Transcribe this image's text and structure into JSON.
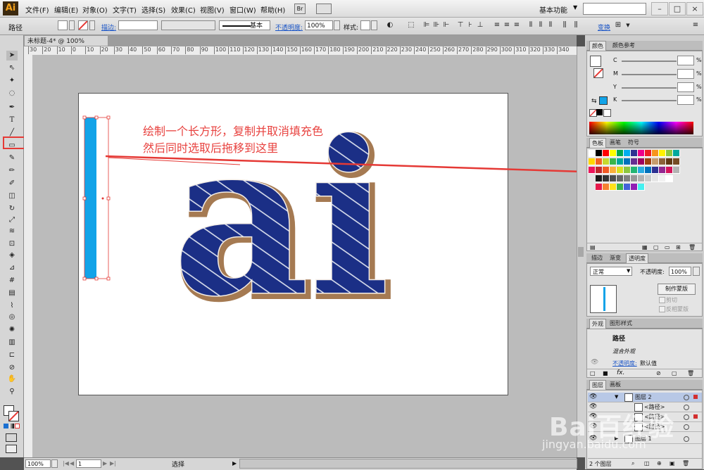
{
  "app": {
    "logo": "Ai",
    "menus": [
      "文件(F)",
      "编辑(E)",
      "对象(O)",
      "文字(T)",
      "选择(S)",
      "效果(C)",
      "视图(V)",
      "窗口(W)",
      "帮助(H)"
    ],
    "bridge_label": "Br",
    "workspace": "基本功能",
    "window_buttons": [
      "–",
      "□",
      "×"
    ]
  },
  "control_bar": {
    "selection_type": "路径",
    "stroke_label": "描边:",
    "stroke_style": "基本",
    "opacity_label": "不透明度:",
    "opacity_value": "100%",
    "style_label": "样式:",
    "transform_label": "变换"
  },
  "document": {
    "tab_title": "未标题-4* @ 100% (CMYK/预览)",
    "ruler_ticks": [
      "30",
      "20",
      "10",
      "0",
      "10",
      "20",
      "30",
      "40",
      "50",
      "60",
      "70",
      "80",
      "90",
      "100",
      "110",
      "120",
      "130",
      "140",
      "150",
      "160",
      "170",
      "180",
      "190",
      "200",
      "210",
      "220",
      "230",
      "240",
      "250",
      "260",
      "270",
      "280",
      "290",
      "300",
      "310",
      "320",
      "330",
      "340"
    ],
    "annotation_line1": "绘制一个长方形，复制并取消填充色",
    "annotation_line2": "然后同时选取后拖移到这里",
    "artwork_text": "ai",
    "accent_color": "#e53935",
    "fill_blue": "#12a3e8",
    "letter_blue": "#1b2f86"
  },
  "status_bar": {
    "zoom": "100%",
    "page": "1",
    "tool": "选择"
  },
  "color_panel": {
    "tabs": [
      "颜色",
      "颜色参考"
    ],
    "channels": [
      "C",
      "M",
      "Y",
      "K"
    ],
    "pct": "%"
  },
  "swatches_panel": {
    "tabs": [
      "色板",
      "画笔",
      "符号"
    ]
  },
  "transparency_panel": {
    "tabs": [
      "描边",
      "渐变",
      "透明度"
    ],
    "blend_mode": "正常",
    "opacity_label": "不透明度:",
    "opacity_value": "100%",
    "make_mask_button": "制作蒙版",
    "clip_label": "剪切",
    "invert_label": "反相蒙版"
  },
  "appearance_panel": {
    "tabs": [
      "外观",
      "图形样式"
    ],
    "title": "路径",
    "mixed": "混合外观",
    "opacity_link": "不透明度:",
    "opacity_value": "默认值",
    "fx": "fx."
  },
  "layers_panel": {
    "tabs": [
      "图层",
      "画板"
    ],
    "rows": [
      {
        "name": "图层 2"
      },
      {
        "name": "<路径>"
      },
      {
        "name": "<路径>"
      },
      {
        "name": "<路径>"
      },
      {
        "name": "图层 1"
      }
    ],
    "count": "2 个图层"
  },
  "watermark": {
    "brand": "Bai百经验",
    "url": "jingyan.baidu.com"
  },
  "swatch_colors": [
    [
      "#ffffff",
      "#000000",
      "#ff0000",
      "#ffff00",
      "#00a651",
      "#00aeef",
      "#2e3192",
      "#ec008c",
      "#ed1c24",
      "#f7941d",
      "#fff200",
      "#8dc63f",
      "#00a99d"
    ],
    [
      "#ffd700",
      "#f26522",
      "#c6d82e",
      "#39b54a",
      "#00a69c",
      "#0072bc",
      "#662d91",
      "#9e005d",
      "#a0410d",
      "#c69c6d",
      "#8c6239",
      "#603913",
      "#754c24"
    ],
    [
      "#ed145b",
      "#c1272d",
      "#f15a24",
      "#fbb03b",
      "#d9e021",
      "#8cc63f",
      "#22b573",
      "#29abe2",
      "#0071bc",
      "#2e3192",
      "#93278f",
      "#d4145a",
      "#b3b3b3"
    ],
    [
      "#1a1a1a",
      "#333333",
      "#4d4d4d",
      "#666666",
      "#808080",
      "#999999",
      "#b3b3b3",
      "#cccccc",
      "#e6e6e6",
      "#f2f2f2",
      "#ffffff"
    ],
    [
      "#e6194b",
      "#f58231",
      "#ffe119",
      "#3cb44b",
      "#4363d8",
      "#911eb4",
      "#46f0f0"
    ]
  ]
}
